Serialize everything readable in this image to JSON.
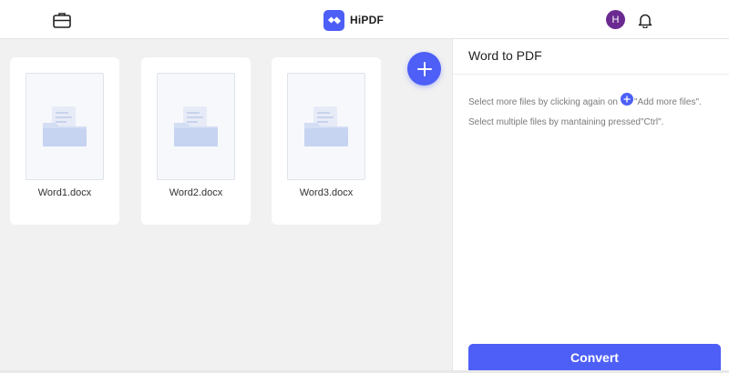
{
  "header": {
    "brand_name": "HiPDF",
    "avatar_initial": "H",
    "icons": {
      "toolbox": "briefcase-icon",
      "brand": "hipdf-logo-icon",
      "notifications": "bell-icon"
    }
  },
  "workspace": {
    "files": [
      {
        "name": "Word1.docx",
        "icon": "folder-document-icon"
      },
      {
        "name": "Word2.docx",
        "icon": "folder-document-icon"
      },
      {
        "name": "Word3.docx",
        "icon": "folder-document-icon"
      }
    ],
    "add_button_icon": "plus-icon"
  },
  "panel": {
    "title": "Word to PDF",
    "hint_prefix": "Select more files by clicking again on",
    "hint_suffix": "\"Add more files\".",
    "hint_multiple": "Select multiple files by mantaining pressed\"Ctrl\".",
    "convert_label": "Convert"
  },
  "colors": {
    "accent": "#4d5ff6",
    "avatar": "#6b2a91",
    "workspace_bg": "#f1f1f1",
    "text_muted": "#7a7a7a"
  }
}
